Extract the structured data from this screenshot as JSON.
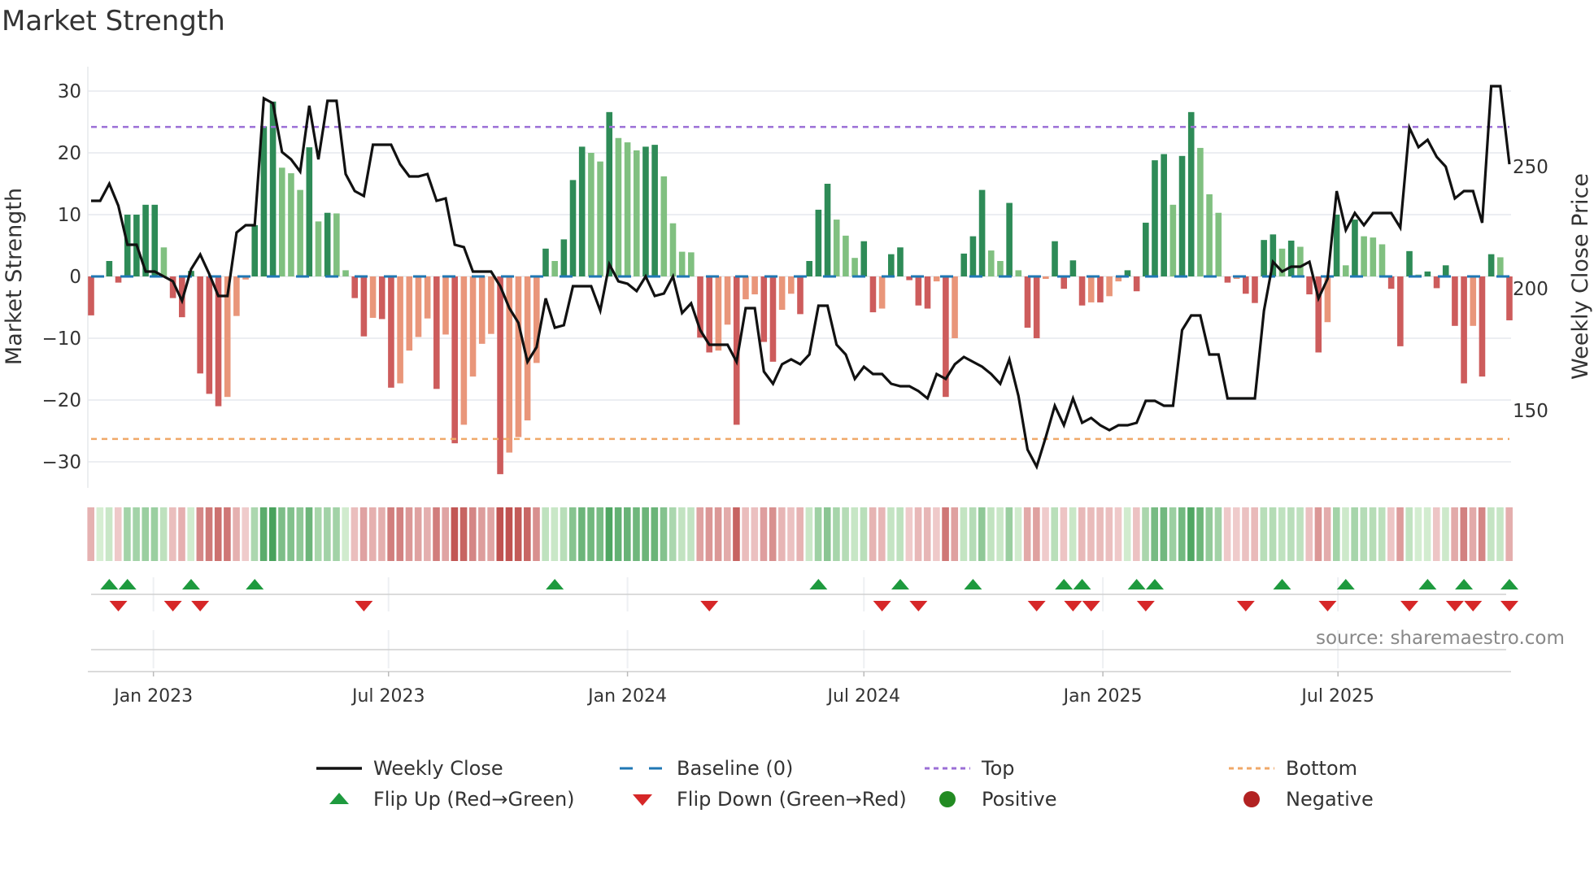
{
  "title": "Market Strength",
  "source": "source: sharemaestro.com",
  "colors": {
    "up_strong": "#2e8b57",
    "up_weak": "#80c080",
    "down_strong": "#cd5c5c",
    "down_weak": "#e9967a",
    "close": "#111111",
    "baseline": "#1f77b4",
    "top": "#9b6fd6",
    "bottom": "#f0a868",
    "flip_up": "#1e9a3e",
    "flip_down": "#d62728",
    "positive": "#228b22",
    "negative": "#b22222"
  },
  "legend": [
    {
      "key": "close",
      "label": "Weekly Close"
    },
    {
      "key": "baseline",
      "label": "Baseline (0)"
    },
    {
      "key": "top",
      "label": "Top"
    },
    {
      "key": "bottom",
      "label": "Bottom"
    },
    {
      "key": "flip_up",
      "label": "Flip Up (Red→Green)"
    },
    {
      "key": "flip_down",
      "label": "Flip Down (Green→Red)"
    },
    {
      "key": "positive",
      "label": "Positive"
    },
    {
      "key": "negative",
      "label": "Negative"
    }
  ],
  "chart_data": {
    "type": "bar",
    "title": "Market Strength",
    "ylabel": "Market Strength",
    "y2label": "Weekly Close Price",
    "ylim": [
      -35,
      35
    ],
    "y2lim": [
      118,
      294
    ],
    "yticks": [
      {
        "v": 30,
        "label": "30"
      },
      {
        "v": 20,
        "label": "20"
      },
      {
        "v": 10,
        "label": "10"
      },
      {
        "v": 0,
        "label": "0"
      },
      {
        "v": -10,
        "label": "−10"
      },
      {
        "v": -20,
        "label": "−20"
      },
      {
        "v": -30,
        "label": "−30"
      }
    ],
    "y2ticks": [
      {
        "v": 250,
        "label": "250"
      },
      {
        "v": 200,
        "label": "200"
      },
      {
        "v": 150,
        "label": "150"
      }
    ],
    "xticks": [
      {
        "date": "2023-01-01",
        "label": "Jan 2023"
      },
      {
        "date": "2023-07-01",
        "label": "Jul 2023"
      },
      {
        "date": "2024-01-01",
        "label": "Jan 2024"
      },
      {
        "date": "2024-07-01",
        "label": "Jul 2024"
      },
      {
        "date": "2025-01-01",
        "label": "Jan 2025"
      },
      {
        "date": "2025-07-01",
        "label": "Jul 2025"
      }
    ],
    "start_date": "2022-11-14",
    "frequency": "weekly",
    "top_level": 24.2,
    "bottom_level": -26.3,
    "baseline": 0,
    "strength": [
      -6.3,
      0,
      2.5,
      -1,
      10,
      10,
      11.6,
      11.6,
      4.7,
      -3.5,
      -6.6,
      0.9,
      -15.7,
      -19,
      -21,
      -19.5,
      -6.4,
      -0.5,
      8.3,
      24.3,
      28.3,
      17.6,
      16.7,
      14,
      20.9,
      8.9,
      10.3,
      10.2,
      1,
      -3.5,
      -9.7,
      -6.7,
      -6.9,
      -18,
      -17.3,
      -12,
      -9.8,
      -6.8,
      -18.2,
      -9.4,
      -27,
      -24,
      -16.2,
      -10.9,
      -9.3,
      -32,
      -28.5,
      -26,
      -23.3,
      -14,
      4.5,
      2.5,
      6,
      15.6,
      21,
      20,
      18.6,
      26.6,
      22.4,
      21.7,
      20.4,
      21,
      21.3,
      16.2,
      8.6,
      4,
      3.9,
      -9.9,
      -12.3,
      -12,
      -7.8,
      -24,
      -3.7,
      -2.9,
      -10.6,
      -13.8,
      -5.4,
      -2.8,
      -6.1,
      2.5,
      10.8,
      15,
      9.2,
      6.6,
      3,
      5.7,
      -5.8,
      -5.2,
      3.6,
      4.7,
      -0.6,
      -4.7,
      -5.2,
      -0.8,
      -19.5,
      -10,
      3.7,
      6.5,
      14,
      4.2,
      2.5,
      11.9,
      1,
      -8.3,
      -10,
      -0.4,
      5.7,
      -2,
      2.6,
      -4.7,
      -4.2,
      -4.2,
      -3.2,
      -0.8,
      1,
      -2.4,
      8.7,
      18.8,
      19.8,
      11.6,
      19.5,
      26.6,
      20.8,
      13.3,
      10.3,
      -1,
      -0.4,
      -2.8,
      -4.3,
      5.9,
      6.8,
      4.5,
      5.8,
      4.8,
      -2.9,
      -12.3,
      -7.4,
      10,
      1.8,
      9.2,
      6.5,
      6.3,
      5.2,
      -2,
      -11.3,
      4.1,
      0.3,
      0.8,
      -1.9,
      1.8,
      -8,
      -17.3,
      -8,
      -16.2,
      3.6,
      3.1,
      -7.1
    ],
    "close": [
      236,
      236,
      243,
      234,
      218,
      218,
      207,
      207,
      205,
      203,
      195,
      208,
      214,
      206,
      197,
      197,
      223,
      226,
      226,
      278,
      276,
      256,
      253,
      248,
      275,
      253,
      277,
      277,
      247,
      240,
      238,
      259,
      259,
      259,
      251,
      246,
      246,
      247,
      236,
      237,
      218,
      217,
      207,
      207,
      207,
      201,
      192,
      186,
      170,
      176,
      196,
      184,
      185,
      201,
      201,
      201,
      191,
      210,
      203,
      202,
      199,
      205,
      197,
      198,
      205,
      190,
      194,
      183,
      177,
      177,
      177,
      170,
      192,
      192,
      166,
      161,
      169,
      171,
      169,
      173,
      193,
      193,
      177,
      173,
      163,
      168,
      165,
      165,
      161,
      160,
      160,
      158,
      155,
      165,
      163,
      169,
      172,
      170,
      168,
      165,
      161,
      171,
      156,
      134,
      127,
      139,
      152,
      144,
      155,
      145,
      147,
      144,
      142,
      144,
      144,
      145,
      154,
      154,
      152,
      152,
      183,
      189,
      189,
      173,
      173,
      155,
      155,
      155,
      155,
      191,
      211,
      207,
      209,
      209,
      211,
      196,
      204,
      240,
      224,
      231,
      226,
      231,
      231,
      231,
      225,
      266,
      258,
      261,
      254,
      250,
      237,
      240,
      240,
      227,
      283,
      283,
      251
    ],
    "flip_up_weeks": [
      2,
      4,
      11,
      18,
      51,
      80,
      89,
      97,
      107,
      109,
      115,
      117,
      131,
      138,
      147,
      151,
      156
    ],
    "flip_down_weeks": [
      3,
      9,
      12,
      30,
      68,
      87,
      91,
      104,
      108,
      110,
      116,
      127,
      136,
      145,
      150,
      152,
      158
    ]
  }
}
